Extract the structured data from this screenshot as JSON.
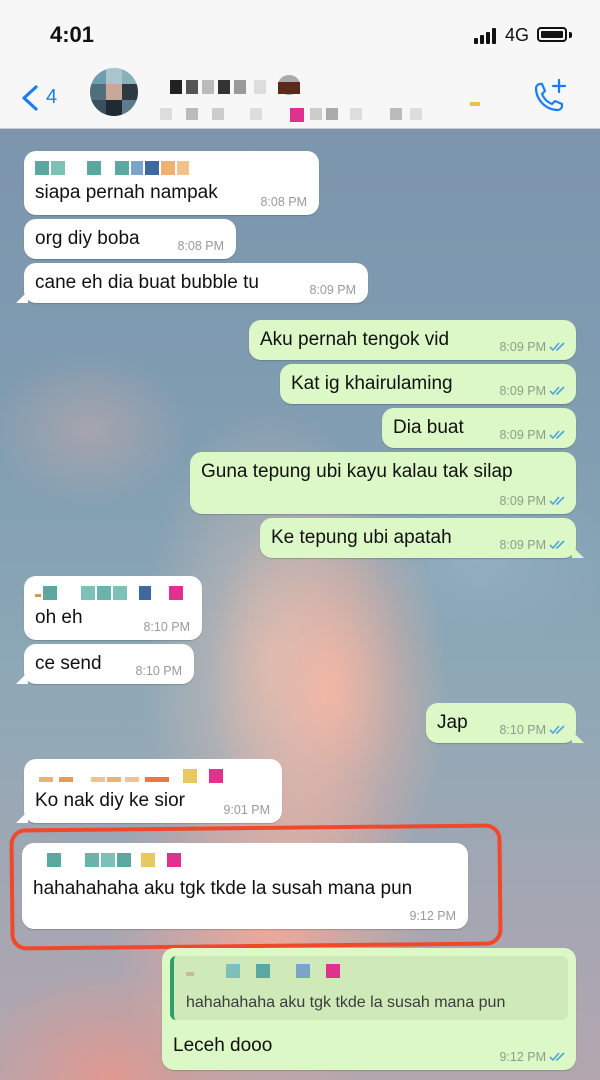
{
  "status_bar": {
    "time": "4:01",
    "network": "4G"
  },
  "nav": {
    "back_count": "4"
  },
  "messages": [
    {
      "text": "siapa pernah nampak",
      "time": "8:08 PM"
    },
    {
      "text": "org diy boba",
      "time": "8:08 PM"
    },
    {
      "text": "cane eh dia buat bubble tu",
      "time": "8:09 PM"
    },
    {
      "text": "Aku pernah tengok vid",
      "time": "8:09 PM"
    },
    {
      "text": "Kat ig khairulaming",
      "time": "8:09 PM"
    },
    {
      "text": "Dia buat",
      "time": "8:09 PM"
    },
    {
      "text": "Guna tepung ubi kayu kalau tak silap",
      "time": "8:09 PM"
    },
    {
      "text": "Ke tepung ubi apatah",
      "time": "8:09 PM"
    },
    {
      "text": "oh eh",
      "time": "8:10 PM"
    },
    {
      "text": "ce send",
      "time": "8:10 PM"
    },
    {
      "text": "Jap",
      "time": "8:10 PM"
    },
    {
      "text": "Ko nak diy ke sior",
      "time": "9:01 PM"
    },
    {
      "text": "hahahahaha aku tgk tkde la susah mana pun",
      "time": "9:12 PM"
    },
    {
      "quote": "hahahahaha aku tgk tkde la susah mana pun",
      "text": "Leceh dooo",
      "time": "9:12 PM"
    }
  ],
  "colors": {
    "incoming_bubble": "#ffffff",
    "outgoing_bubble": "#dcf8c6",
    "ios_blue": "#1a7ef2",
    "read_tick_blue": "#4fa3e0",
    "highlight_ring": "#f0482b"
  },
  "icons": {
    "back": "chevron-left-icon",
    "call": "phone-plus-icon",
    "read_receipt": "double-check-icon",
    "battery": "battery-icon",
    "signal": "signal-icon"
  }
}
